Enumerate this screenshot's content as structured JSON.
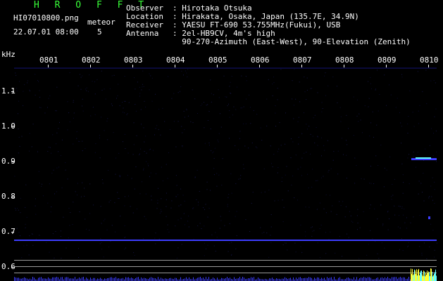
{
  "header": {
    "brand": "H R O F F T",
    "filename": "HI07010800.png",
    "datetime": "22.07.01 08:00",
    "count_label": "meteor",
    "count_value": "5"
  },
  "meta": [
    {
      "key": "Observer",
      "value": ": Hirotaka Otsuka"
    },
    {
      "key": "Location",
      "value": ": Hirakata, Osaka, Japan (135.7E, 34.9N)"
    },
    {
      "key": "Receiver",
      "value": ": YAESU FT-690 53.755MHz(Fukui), USB"
    },
    {
      "key": "Antenna",
      "value": ": 2el-HB9CV, 4m's high"
    },
    {
      "key": "",
      "value": "  90-270-Azimuth (East-West), 90-Elevation (Zenith)"
    }
  ],
  "axis": {
    "unit": "kHz",
    "y_ticks": [
      "1.1",
      "1.0",
      "0.9",
      "0.8",
      "0.7",
      "0.6"
    ],
    "x_ticks": [
      "0801",
      "0802",
      "0803",
      "0804",
      "0805",
      "0806",
      "0807",
      "0808",
      "0809",
      "0810"
    ]
  },
  "colors": {
    "background": "#000000",
    "signal": "#3d3dff",
    "brand": "#39ff39",
    "echo": "#66ffff",
    "noise_peak": "#ffff33"
  }
}
